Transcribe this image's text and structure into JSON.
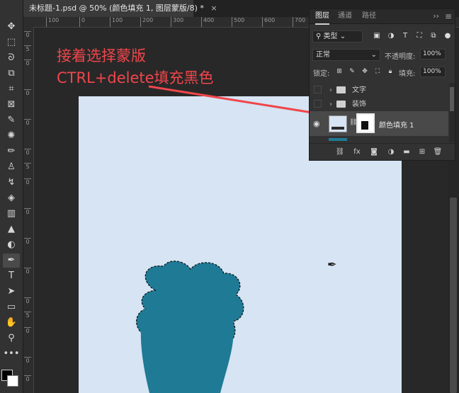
{
  "document": {
    "tab_title": "未标题-1.psd @ 50% (颜色填充 1, 图层蒙版/8) *",
    "close": "×"
  },
  "ruler": {
    "top_ticks": [
      "100",
      "0",
      "100",
      "200",
      "300",
      "400",
      "500",
      "600",
      "700"
    ],
    "left_ticks": [
      "0",
      "5",
      "0",
      "0",
      "0",
      "0",
      "5",
      "0",
      "0",
      "0",
      "0",
      "0",
      "5",
      "0",
      "0",
      "0",
      "0",
      "0"
    ]
  },
  "annotation": {
    "line1": "接着选择蒙版",
    "line2": "CTRL+delete填充黑色",
    "color": "#f0464b"
  },
  "layers_panel": {
    "tabs": [
      "图层",
      "通道",
      "路径"
    ],
    "collapse_icon": "››",
    "menu_icon": "≡",
    "filter": {
      "label": "类型",
      "icons": [
        "image-icon",
        "adjustment-icon",
        "type-icon",
        "shape-icon",
        "smart-object-icon",
        "toggle-icon"
      ]
    },
    "blend_mode": "正常",
    "opacity_label": "不透明度:",
    "opacity_value": "100%",
    "lock_label": "锁定:",
    "fill_label": "填充:",
    "fill_value": "100%",
    "layers": [
      {
        "name": "文字",
        "type": "group"
      },
      {
        "name": "装饰",
        "type": "group"
      },
      {
        "name": "颜色填充 1",
        "type": "fill",
        "selected": true
      }
    ],
    "bottom_icons": [
      "link-icon",
      "fx-icon",
      "mask-icon",
      "adjustment-layer-icon",
      "group-icon",
      "new-layer-icon",
      "trash-icon"
    ]
  },
  "colors": {
    "canvas": "#d6e4f3",
    "shape": "#1f7a95",
    "panel": "#323232"
  }
}
